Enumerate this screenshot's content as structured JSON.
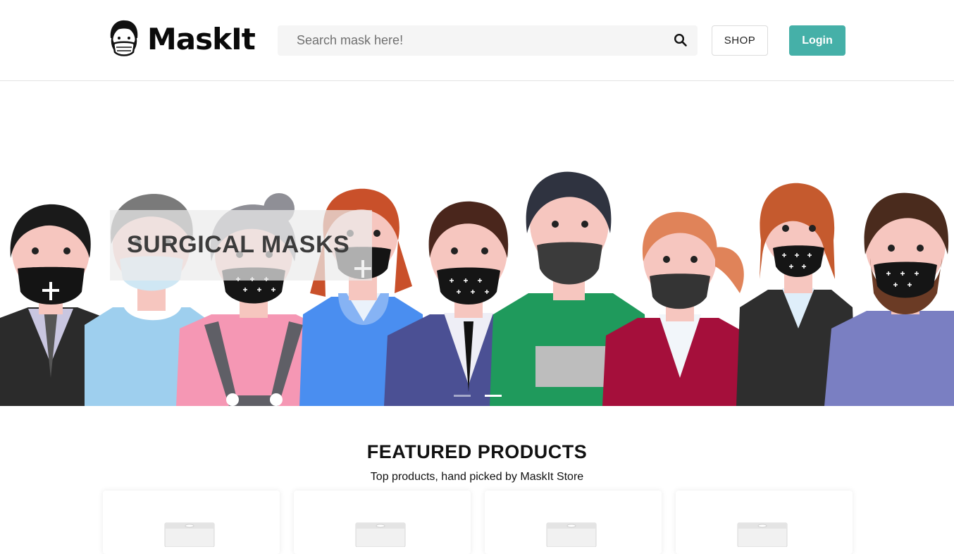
{
  "brand": {
    "name": "MaskIt"
  },
  "search": {
    "placeholder": "Search mask here!"
  },
  "nav": {
    "shop_label": "SHOP",
    "login_label": "Login"
  },
  "hero": {
    "caption": "SURGICAL MASKS",
    "slides_total": 2,
    "active_slide": 2
  },
  "featured": {
    "title": "FEATURED PRODUCTS",
    "subtitle": "Top products, hand picked by MaskIt Store"
  },
  "colors": {
    "accent": "#45b0a8",
    "search_bg": "#f5f5f5"
  },
  "icons": {
    "logo": "masked-face-icon",
    "search": "search-icon",
    "product": "mask-package-icon"
  }
}
